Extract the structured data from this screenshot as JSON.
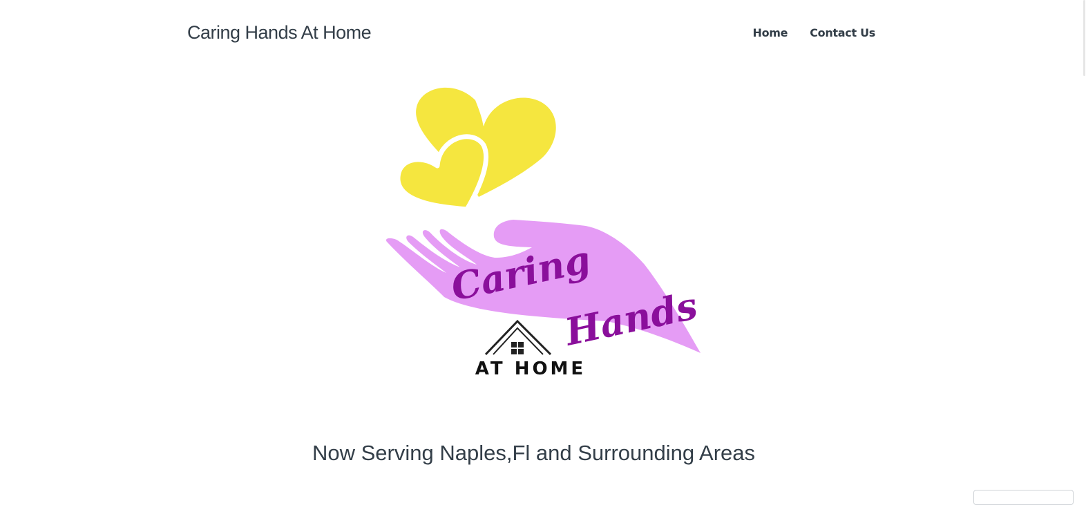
{
  "header": {
    "site_title": "Caring Hands At Home",
    "nav": [
      {
        "label": "Home"
      },
      {
        "label": "Contact Us"
      }
    ]
  },
  "logo": {
    "script_line1": "Caring",
    "script_line2": "Hands",
    "subtitle": "AT HOME",
    "colors": {
      "hearts": "#f5e63f",
      "hand": "#e59cf5",
      "script_text": "#8a0f9b",
      "house": "#222222"
    }
  },
  "main": {
    "tagline": "Now Serving Naples,Fl and Surrounding Areas"
  }
}
